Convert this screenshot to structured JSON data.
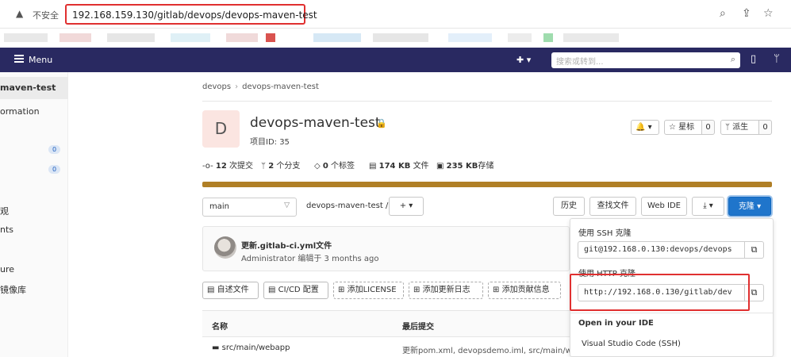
{
  "browser": {
    "insecure_label": "不安全",
    "url": "192.168.159.130/gitlab/devops/devops-maven-test",
    "icons": [
      "warning-icon",
      "zoom-icon",
      "share-icon",
      "star-icon"
    ]
  },
  "topnav": {
    "menu_label": "Menu",
    "search_placeholder": "搜索或转到...",
    "plus_glyph": "✚ ▾",
    "icons": [
      "hamburger-icon",
      "search-icon",
      "issues-icon",
      "merge-request-icon"
    ]
  },
  "sidebar": {
    "items": [
      {
        "label": "maven-test"
      },
      {
        "label": "ormation"
      },
      {
        "label": ""
      },
      {
        "label": ""
      },
      {
        "label": "观"
      },
      {
        "label": "nts"
      },
      {
        "label": "ure"
      },
      {
        "label": "镜像库"
      }
    ],
    "badges": [
      "0",
      "0"
    ]
  },
  "breadcrumb": [
    "devops",
    "devops-maven-test"
  ],
  "project": {
    "avatar_letter": "D",
    "title": "devops-maven-test",
    "id_text": "项目ID: 35",
    "notify_label": "🔔 ▾",
    "star_label": "☆ 星标",
    "star_count": "0",
    "fork_label": "ᛘ 派生",
    "fork_count": "0"
  },
  "stats": {
    "commits_num": "12",
    "commits_label": "次提交",
    "branches_num": "2",
    "branches_label": "个分支",
    "tags_num": "0",
    "tags_label": "个标签",
    "files_num": "174 KB",
    "files_label": "文件",
    "storage_num": "235 KB",
    "storage_label": "存储"
  },
  "toolbar": {
    "branch": "main",
    "path": "devops-maven-test  /",
    "add_label": "+ ▾",
    "history": "历史",
    "find_file": "查找文件",
    "web_ide": "Web IDE",
    "download": "⤓ ▾",
    "clone": "克隆 ▾"
  },
  "commit": {
    "title": "更新.gitlab-ci.yml文件",
    "author": "Administrator",
    "edited": "编辑于",
    "time": "3 months ago"
  },
  "quick_buttons": {
    "readme": "自述文件",
    "cicd": "CI/CD 配置",
    "license": "添加LICENSE",
    "changelog": "添加更新日志",
    "contributing": "添加贡献信息"
  },
  "table": {
    "headers": [
      "名称",
      "最后提交"
    ],
    "rows": [
      {
        "name": "src/main/webapp",
        "last_commit": "更新pom.xml, devopsdemo.iml, src/main/we..."
      }
    ]
  },
  "clone_panel": {
    "ssh_label": "使用 SSH 克隆",
    "ssh_url": "git@192.168.0.130:devops/devops",
    "http_label": "使用 HTTP 克隆",
    "http_url": "http://192.168.0.130/gitlab/dev",
    "ide_label": "Open in your IDE",
    "ide_option": "Visual Studio Code (SSH)"
  },
  "colors": {
    "navbar": "#292961",
    "clone_button": "#1f75cb",
    "language_bar": "#b07f26",
    "highlight": "#e03030"
  }
}
